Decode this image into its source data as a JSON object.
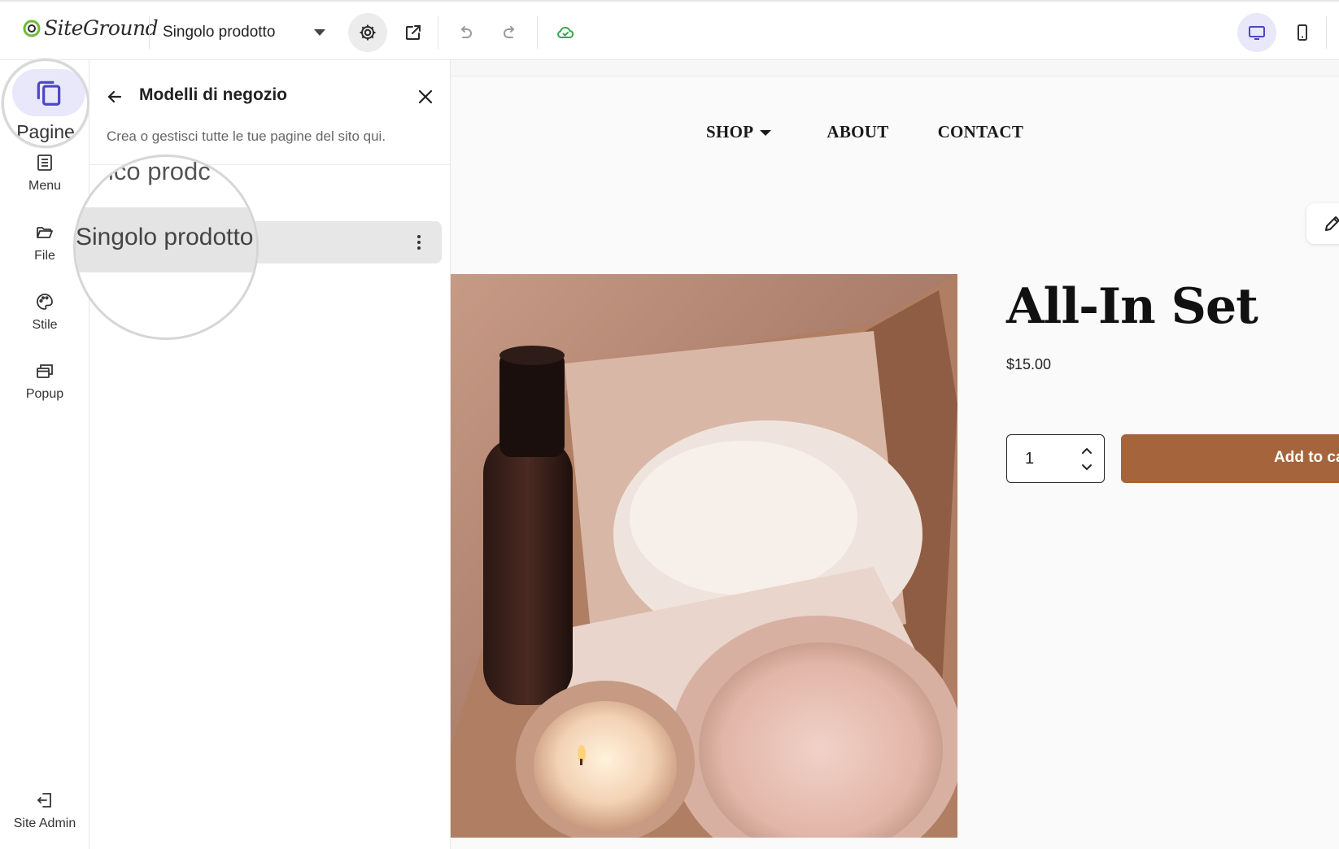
{
  "app": {
    "brand": "SiteGround"
  },
  "toolbar": {
    "page_selector": "Singolo prodotto"
  },
  "rail": {
    "items": [
      {
        "label": "Pagine"
      },
      {
        "label": "Menu"
      },
      {
        "label": "File"
      },
      {
        "label": "Stile"
      },
      {
        "label": "Popup"
      },
      {
        "label": "Site Admin"
      }
    ]
  },
  "panel": {
    "title": "Modelli di negozio",
    "description": "Crea o gestisci tutte le tue pagine del sito qui.",
    "partial_item": "ico prodc",
    "selected_item": "Singolo prodotto"
  },
  "preview": {
    "nav": {
      "shop": "SHOP",
      "about": "ABOUT",
      "contact": "CONTACT"
    },
    "product": {
      "title": "All-In Set",
      "price": "$15.00",
      "quantity": "1",
      "add_to_cart": "Add to cart"
    }
  },
  "colors": {
    "accent_light": "#e9e8fb",
    "accent": "#4b46c4",
    "cta": "#a5643b",
    "logo_green": "#6cbb3c"
  }
}
